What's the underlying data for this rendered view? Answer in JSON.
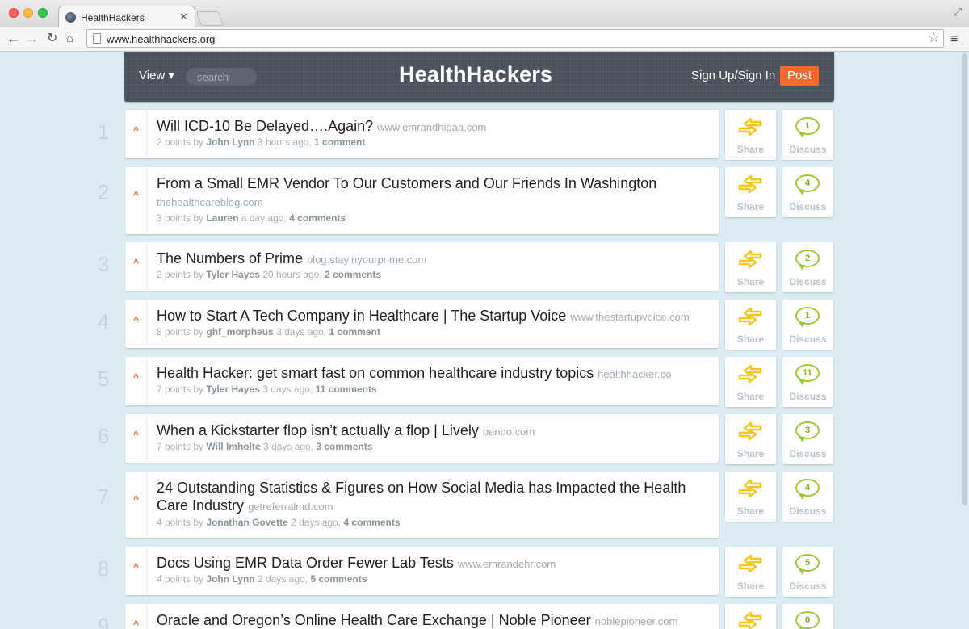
{
  "browser": {
    "tab_title": "HealthHackers",
    "tab_close": "✕",
    "url": "www.healthhackers.org"
  },
  "header": {
    "view_label": "View ▾",
    "search_placeholder": "search",
    "logo": "HealthHackers",
    "signin_label": "Sign Up/Sign In",
    "post_label": "Post"
  },
  "actions": {
    "share_label": "Share",
    "discuss_label": "Discuss"
  },
  "colors": {
    "accent": "#f26a2c",
    "header_bg": "#4b535c",
    "bubble_green": "#9cc93a",
    "share_yellow": "#f2c81c",
    "page_bg": "#dcecf4"
  },
  "icons": [
    "back-arrow-icon",
    "forward-arrow-icon",
    "reload-icon",
    "home-icon",
    "page-icon",
    "star-icon",
    "menu-icon",
    "upvote-icon",
    "share-arrows-icon",
    "speech-bubble-icon"
  ],
  "items": [
    {
      "rank": "1",
      "title": "Will ICD-10 Be Delayed….Again?",
      "domain": "www.emrandhipaa.com",
      "points": "2 points by",
      "author": "John Lynn",
      "time": "3 hours ago,",
      "comments": "1 comment",
      "count": "1"
    },
    {
      "rank": "2",
      "title": "From a Small EMR Vendor To Our Customers and Our Friends In Washington",
      "domain": "thehealthcareblog.com",
      "points": "3 points by",
      "author": "Lauren",
      "time": "a day ago,",
      "comments": "4 comments",
      "count": "4"
    },
    {
      "rank": "3",
      "title": "The Numbers of Prime",
      "domain": "blog.stayinyourprime.com",
      "points": "2 points by",
      "author": "Tyler Hayes",
      "time": "20 hours ago,",
      "comments": "2 comments",
      "count": "2"
    },
    {
      "rank": "4",
      "title": "How to Start A Tech Company in Healthcare | The Startup Voice",
      "domain": "www.thestartupvoice.com",
      "points": "8 points by",
      "author": "ghf_morpheus",
      "time": "3 days ago,",
      "comments": "1 comment",
      "count": "1"
    },
    {
      "rank": "5",
      "title": "Health Hacker: get smart fast on common healthcare industry topics",
      "domain": "healthhacker.co",
      "points": "7 points by",
      "author": "Tyler Hayes",
      "time": "3 days ago,",
      "comments": "11 comments",
      "count": "11"
    },
    {
      "rank": "6",
      "title": "When a Kickstarter flop isn’t actually a flop | Lively",
      "domain": "pando.com",
      "points": "7 points by",
      "author": "Will Imholte",
      "time": "3 days ago,",
      "comments": "3 comments",
      "count": "3"
    },
    {
      "rank": "7",
      "title": "24 Outstanding Statistics & Figures on How Social Media has Impacted the Health Care Industry",
      "domain": "getreferralmd.com",
      "points": "4 points by",
      "author": "Jonathan Govette",
      "time": "2 days ago,",
      "comments": "4 comments",
      "count": "4"
    },
    {
      "rank": "8",
      "title": "Docs Using EMR Data Order Fewer Lab Tests",
      "domain": "www.emrandehr.com",
      "points": "4 points by",
      "author": "John Lynn",
      "time": "2 days ago,",
      "comments": "5 comments",
      "count": "5"
    },
    {
      "rank": "9",
      "title": "Oracle and Oregon’s Online Health Care Exchange | Noble Pioneer",
      "domain": "noblepioneer.com",
      "points": "",
      "author": "",
      "time": "",
      "comments": "",
      "count": "0"
    }
  ]
}
